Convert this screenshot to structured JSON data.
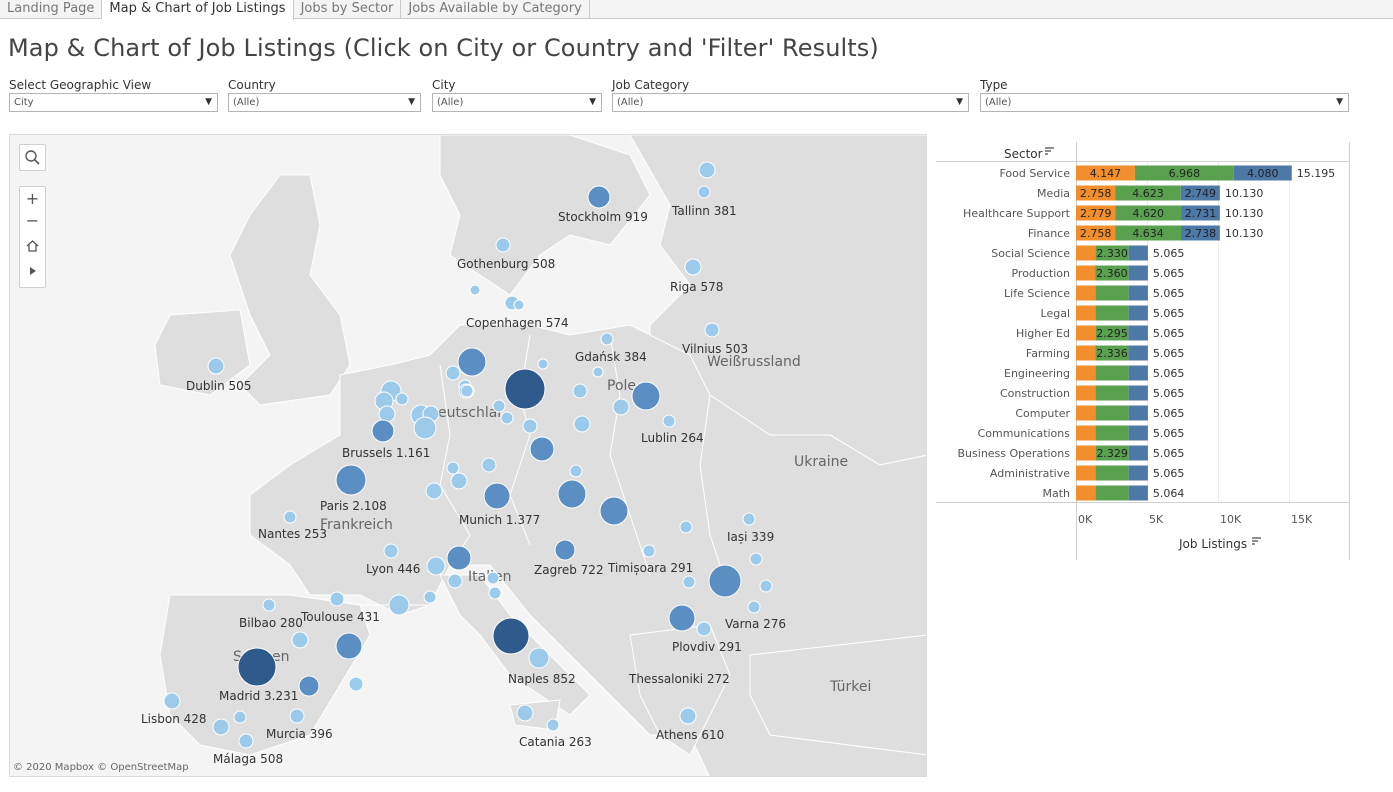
{
  "tabs": [
    {
      "label": "Landing Page",
      "active": false
    },
    {
      "label": "Map & Chart of Job Listings",
      "active": true
    },
    {
      "label": "Jobs by Sector",
      "active": false
    },
    {
      "label": "Jobs Available by Category",
      "active": false
    }
  ],
  "page_title": "Map & Chart of Job Listings (Click on City or Country and 'Filter' Results)",
  "filters": [
    {
      "label": "Select Geographic View",
      "value": "City"
    },
    {
      "label": "Country",
      "value": "(Alle)"
    },
    {
      "label": "City",
      "value": "(Alle)"
    },
    {
      "label": "Job Category",
      "value": "(Alle)"
    },
    {
      "label": "Type",
      "value": "(Alle)"
    }
  ],
  "map": {
    "attribution": "© 2020 Mapbox © OpenStreetMap",
    "country_labels": [
      "Weißrussland",
      "Ukraine",
      "Türkei",
      "Pole",
      "eutschlar",
      "Frankreich",
      "Italien",
      "S",
      "en"
    ],
    "city_labels": [
      "Stockholm 919",
      "Tallinn 381",
      "Gothenburg 508",
      "Riga 578",
      "Copenhagen 574",
      "Vilnius 503",
      "Gdańsk 384",
      "Dublin 505",
      "Lublin 264",
      "Brussels 1.161",
      "Paris 2.108",
      "Munich 1.377",
      "Nantes 253",
      "Iași 339",
      "Zagreb 722",
      "Timișoara 291",
      "Lyon 446",
      "Bilbao 280",
      "Toulouse 431",
      "Varna 276",
      "Plovdiv 291",
      "Madrid 3.231",
      "Naples 852",
      "Thessaloniki 272",
      "Lisbon 428",
      "Murcia 396",
      "Catania 263",
      "Athens 610",
      "Málaga 508"
    ],
    "colors": {
      "dark": "#2e5a8c",
      "mid": "#5b8fc4",
      "light": "#9ccaea",
      "lightest": "#b8daf0"
    }
  },
  "chart_data": {
    "type": "bar",
    "stacked": true,
    "xlabel": "Job Listings",
    "ylabel": "Sector",
    "xlim": [
      0,
      17500
    ],
    "x_ticks": [
      "0K",
      "5K",
      "10K",
      "15K"
    ],
    "categories": [
      "Food Service",
      "Media",
      "Healthcare Support",
      "Finance",
      "Social Science",
      "Production",
      "Life Science",
      "Legal",
      "Higher Ed",
      "Farming",
      "Engineering",
      "Construction",
      "Computer",
      "Communications",
      "Business Operations",
      "Administrative",
      "Math"
    ],
    "series": [
      {
        "color": "#f28e2b",
        "values": [
          4147,
          2758,
          2779,
          2758,
          1380,
          1350,
          1380,
          1380,
          1385,
          1365,
          1380,
          1380,
          1380,
          1380,
          1384,
          1380,
          1380
        ]
      },
      {
        "color": "#59a14f",
        "values": [
          6968,
          4623,
          4620,
          4634,
          2330,
          2360,
          2330,
          2330,
          2295,
          2336,
          2330,
          2330,
          2330,
          2330,
          2329,
          2330,
          2330
        ]
      },
      {
        "color": "#4e79a7",
        "values": [
          4080,
          2749,
          2731,
          2738,
          1355,
          1355,
          1355,
          1355,
          1385,
          1364,
          1355,
          1355,
          1355,
          1355,
          1352,
          1355,
          1354
        ]
      }
    ],
    "segment_labels": [
      [
        "4.147",
        "6.968",
        "4.080"
      ],
      [
        "2.758",
        "4.623",
        "2.749"
      ],
      [
        "2.779",
        "4.620",
        "2.731"
      ],
      [
        "2.758",
        "4.634",
        "2.738"
      ],
      [
        "",
        "2.330",
        ""
      ],
      [
        "",
        "2.360",
        ""
      ],
      [
        "",
        "",
        ""
      ],
      [
        "",
        "",
        ""
      ],
      [
        "",
        "2.295",
        ""
      ],
      [
        "",
        "2.336",
        ""
      ],
      [
        "",
        "",
        ""
      ],
      [
        "",
        "",
        ""
      ],
      [
        "",
        "",
        ""
      ],
      [
        "",
        "",
        ""
      ],
      [
        "",
        "2.329",
        ""
      ],
      [
        "",
        "",
        ""
      ],
      [
        "",
        "",
        ""
      ]
    ],
    "totals": [
      "15.195",
      "10.130",
      "10.130",
      "10.130",
      "5.065",
      "5.065",
      "5.065",
      "5.065",
      "5.065",
      "5.065",
      "5.065",
      "5.065",
      "5.065",
      "5.065",
      "5.065",
      "5.065",
      "5.064"
    ]
  }
}
